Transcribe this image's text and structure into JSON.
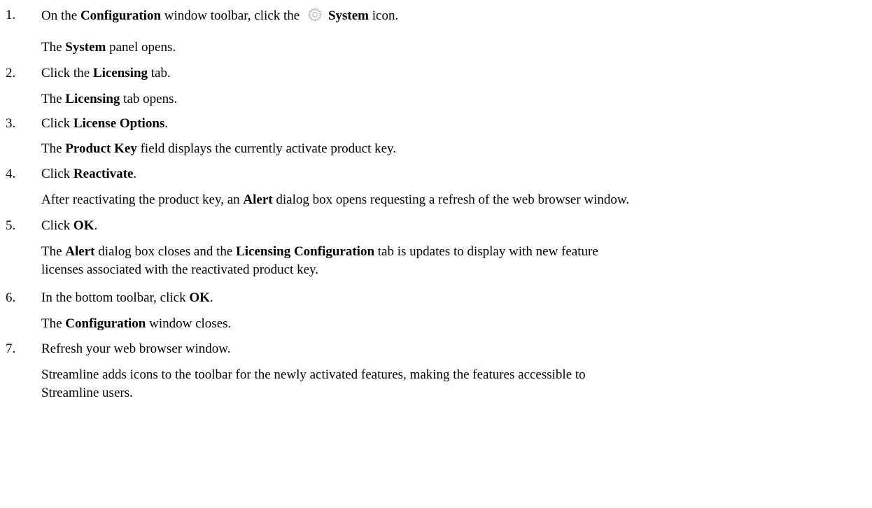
{
  "steps": [
    {
      "num": "1.",
      "line": {
        "a": "On the ",
        "b1": "Configuration",
        "c": " window toolbar, click the ",
        "b2": "System",
        "d": " icon."
      },
      "icon": "gear-icon",
      "result": {
        "a": "The ",
        "b1": "System",
        "c": " panel opens."
      }
    },
    {
      "num": "2.",
      "line": {
        "a": "Click the ",
        "b1": "Licensing",
        "c": " tab."
      },
      "result": {
        "a": "The ",
        "b1": "Licensing",
        "c": " tab opens."
      }
    },
    {
      "num": "3.",
      "line": {
        "a": "Click ",
        "b1": "License Options",
        "c": "."
      },
      "result": {
        "a": "The ",
        "b1": "Product Key",
        "c": " field displays the currently activate product key."
      }
    },
    {
      "num": "4.",
      "line": {
        "a": "Click ",
        "b1": "Reactivate",
        "c": "."
      },
      "result": {
        "a": "After reactivating the product key, an ",
        "b1": "Alert",
        "c": " dialog box opens requesting a refresh of the web browser window."
      }
    },
    {
      "num": "5.",
      "line": {
        "a": "Click ",
        "b1": "OK",
        "c": "."
      },
      "result": {
        "a": "The ",
        "b1": "Alert",
        "c": " dialog box closes and the ",
        "b2": "Licensing Configuration",
        "d1": " tab is updates to display with new feature",
        "d2": "licenses associated with the reactivated product key."
      }
    },
    {
      "num": "6.",
      "line": {
        "a": "In the bottom toolbar, click ",
        "b1": "OK",
        "c": "."
      },
      "result": {
        "a": "The ",
        "b1": "Configuration",
        "c": " window closes."
      }
    },
    {
      "num": "7.",
      "line": {
        "a": "Refresh your web browser window."
      },
      "result": {
        "a1": "Streamline adds icons to the toolbar for the newly activated features, making the features accessible to",
        "a2": "Streamline users."
      }
    }
  ]
}
